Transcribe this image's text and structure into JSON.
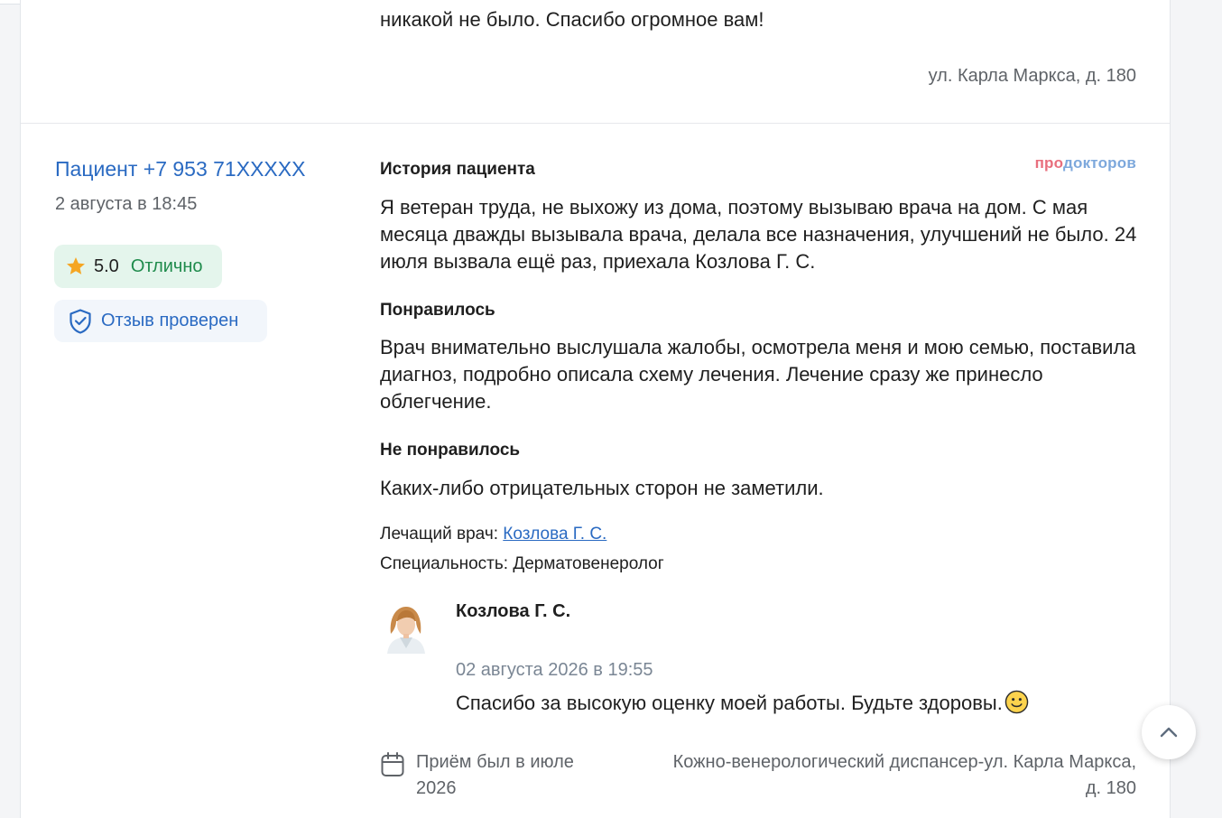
{
  "previous_review": {
    "text_tail": "никакой не было. Спасибо огромное вам!",
    "address": "ул. Карла Маркса, д. 180"
  },
  "review": {
    "author": "Пациент +7 953 71XXXXX",
    "date": "2 августа в 18:45",
    "rating": {
      "score": "5.0",
      "label": "Отлично",
      "star_color": "#f5a623",
      "badge_color": "#e4f5ec"
    },
    "verified_label": "Отзыв проверен",
    "brand": {
      "part1": "про",
      "part2": "докторов"
    },
    "history_title": "История пациента",
    "history_text": "Я ветеран труда, не выхожу из дома, поэтому вызываю врача на дом. С мая месяца дважды вызывала врача, делала все назначения, улучшений не было. 24 июля вызвала ещё раз, приехала Козлова Г. С.",
    "liked_title": "Понравилось",
    "liked_text": "Врач внимательно выслушала жалобы, осмотрела меня и мою семью, поставила диагноз, подробно описала схему лечения. Лечение сразу же принесло облегчение.",
    "disliked_title": "Не понравилось",
    "disliked_text": "Каких-либо отрицательных сторон не заметили.",
    "doctor_label": "Лечащий врач:",
    "doctor_name": "Козлова Г. С.",
    "specialty_label": "Специальность:",
    "specialty": "Дерматовенеролог",
    "reply": {
      "name": "Козлова Г. С.",
      "date": "02 августа 2026 в 19:55",
      "text": "Спасибо за высокую оценку моей работы. Будьте здоровы."
    },
    "visit": "Приём был в июле 2026",
    "clinic": "Кожно-венерологический диспансер-ул. Карла Маркса, д. 180"
  },
  "icons": {
    "star": "star-icon",
    "shield": "shield-check-icon",
    "calendar": "calendar-icon",
    "scroll_top": "chevron-up-icon",
    "smile": "smile-emoji-icon"
  },
  "colors": {
    "link": "#2a6ac2",
    "accent_green": "#1f8b4c"
  }
}
